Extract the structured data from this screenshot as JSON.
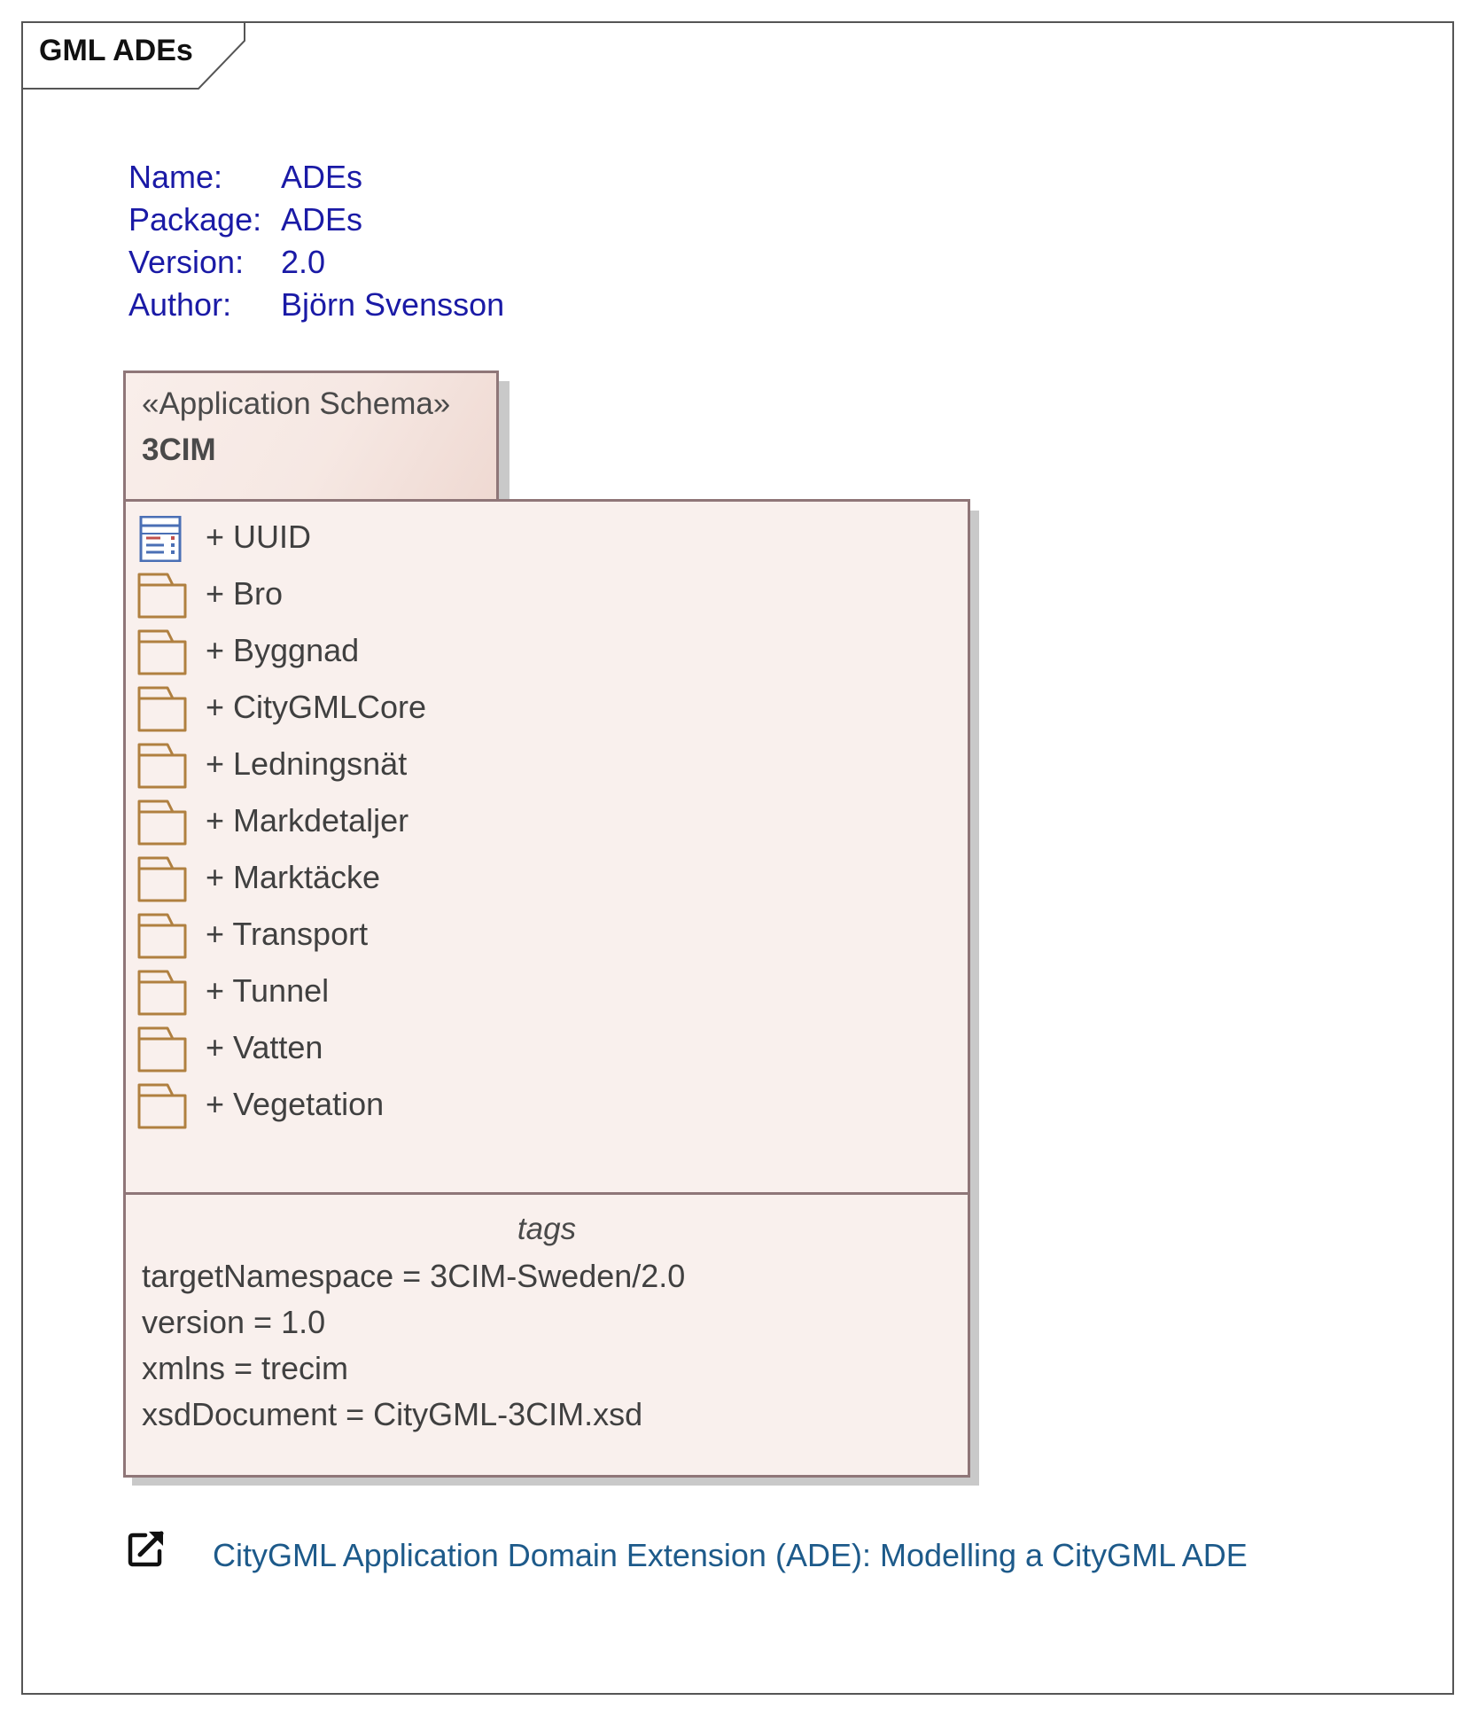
{
  "frame": {
    "title": "GML ADEs"
  },
  "info": {
    "rows": [
      {
        "label": "Name:",
        "value": "ADEs"
      },
      {
        "label": "Package:",
        "value": "ADEs"
      },
      {
        "label": "Version:",
        "value": "2.0"
      },
      {
        "label": "Author:",
        "value": "Björn Svensson"
      }
    ]
  },
  "package": {
    "stereotype": "«Application Schema»",
    "name": "3CIM",
    "items": [
      {
        "label": "+ UUID",
        "icon": "class-icon"
      },
      {
        "label": "+ Bro",
        "icon": "folder-icon"
      },
      {
        "label": "+ Byggnad",
        "icon": "folder-icon"
      },
      {
        "label": "+ CityGMLCore",
        "icon": "folder-icon"
      },
      {
        "label": "+ Ledningsnät",
        "icon": "folder-icon"
      },
      {
        "label": "+ Markdetaljer",
        "icon": "folder-icon"
      },
      {
        "label": "+ Marktäcke",
        "icon": "folder-icon"
      },
      {
        "label": "+ Transport",
        "icon": "folder-icon"
      },
      {
        "label": "+ Tunnel",
        "icon": "folder-icon"
      },
      {
        "label": "+ Vatten",
        "icon": "folder-icon"
      },
      {
        "label": "+ Vegetation",
        "icon": "folder-icon"
      }
    ],
    "tags_title": "tags",
    "tags": [
      "targetNamespace = 3CIM-Sweden/2.0",
      "version = 1.0",
      "xmlns = trecim",
      "xsdDocument = CityGML-3CIM.xsd"
    ]
  },
  "link": {
    "icon": "external-link-icon",
    "text": "CityGML Application Domain Extension (ADE): Modelling a CityGML ADE"
  },
  "colors": {
    "info_text": "#1a1aa6",
    "package_border": "#8f7678",
    "package_fill": "#f9f0ed",
    "folder_stroke": "#b08040",
    "link_text": "#1d5a8a"
  }
}
